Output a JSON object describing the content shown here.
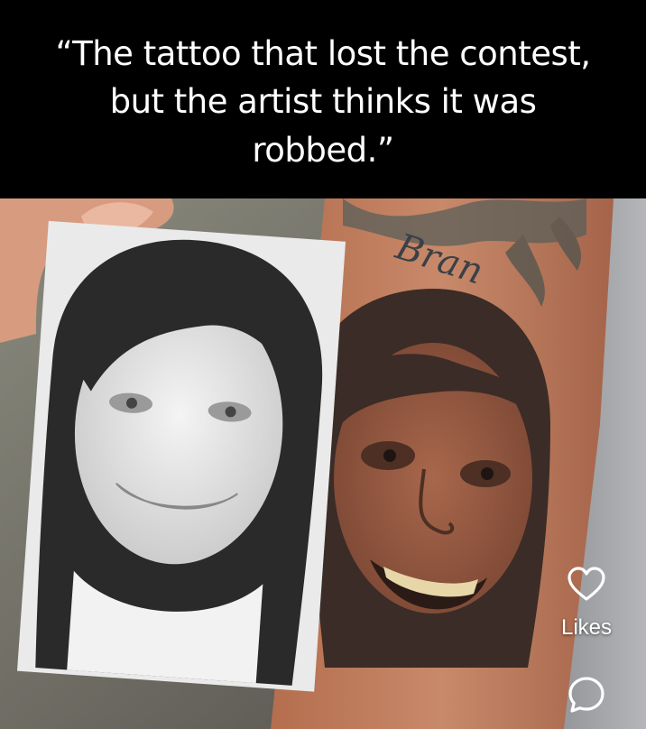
{
  "post": {
    "caption": "“The tattoo that lost the contest, but the artist thinks it was robbed.”",
    "tattoo_lettering": "Bran"
  },
  "actions": {
    "like_icon": "heart-outline-icon",
    "likes_label": "Likes",
    "comment_icon": "comment-bubble-icon"
  },
  "colors": {
    "background": "#000000",
    "caption_text": "#ffffff",
    "icon": "#ffffff"
  }
}
